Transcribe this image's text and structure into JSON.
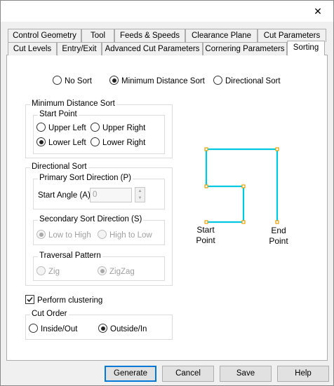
{
  "window": {
    "close_glyph": "✕"
  },
  "tabs": {
    "row_back": [
      "Control Geometry",
      "Tool",
      "Feeds & Speeds",
      "Clearance Plane",
      "Cut Parameters"
    ],
    "row_front": [
      "Cut Levels",
      "Entry/Exit",
      "Advanced Cut Parameters",
      "Cornering Parameters",
      "Sorting"
    ],
    "active": "Sorting"
  },
  "sort_mode": {
    "options": [
      "No Sort",
      "Minimum Distance Sort",
      "Directional Sort"
    ],
    "selected": "Minimum Distance Sort"
  },
  "min_distance": {
    "title": "Minimum Distance Sort",
    "start_point": {
      "title": "Start Point",
      "options": [
        "Upper Left",
        "Upper Right",
        "Lower Left",
        "Lower Right"
      ],
      "selected": "Lower Left"
    }
  },
  "directional": {
    "title": "Directional Sort",
    "primary": {
      "title": "Primary Sort Direction (P)",
      "angle_label": "Start Angle (A)",
      "angle_value": "0"
    },
    "secondary": {
      "title": "Secondary Sort Direction (S)",
      "options": [
        "Low to High",
        "High to Low"
      ],
      "selected": "Low to High"
    },
    "traversal": {
      "title": "Traversal Pattern",
      "options": [
        "Zig",
        "ZigZag"
      ],
      "selected": "ZigZag"
    }
  },
  "clustering": {
    "label": "Perform clustering",
    "checked": true
  },
  "cut_order": {
    "title": "Cut Order",
    "options": [
      "Inside/Out",
      "Outside/In"
    ],
    "selected": "Outside/In"
  },
  "diagram": {
    "start_label": [
      "Start",
      "Point"
    ],
    "end_label": [
      "End",
      "Point"
    ],
    "path_color": "#00c8e0",
    "node_color": "#e8a000"
  },
  "buttons": {
    "generate": "Generate",
    "cancel": "Cancel",
    "save": "Save",
    "help": "Help"
  }
}
